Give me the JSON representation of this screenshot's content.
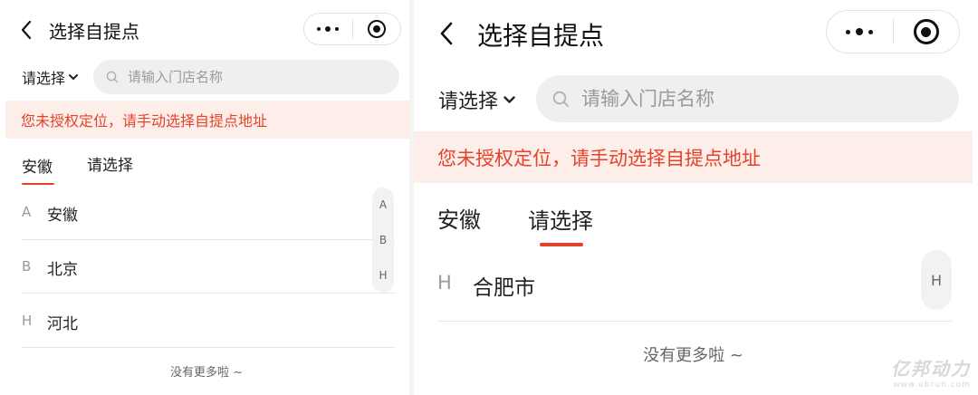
{
  "left": {
    "title": "选择自提点",
    "select_label": "请选择",
    "search_placeholder": "请输入门店名称",
    "notice": "您未授权定位，请手动选择自提点地址",
    "tabs": [
      {
        "label": "安徽",
        "active": true
      },
      {
        "label": "请选择",
        "active": false
      }
    ],
    "items": [
      {
        "letter": "A",
        "name": "安徽"
      },
      {
        "letter": "B",
        "name": "北京"
      },
      {
        "letter": "H",
        "name": "河北"
      }
    ],
    "index": [
      "A",
      "B",
      "H"
    ],
    "footer": "没有更多啦 ~"
  },
  "right": {
    "title": "选择自提点",
    "select_label": "请选择",
    "search_placeholder": "请输入门店名称",
    "notice": "您未授权定位，请手动选择自提点地址",
    "tabs": [
      {
        "label": "安徽",
        "active": false
      },
      {
        "label": "请选择",
        "active": true
      }
    ],
    "items": [
      {
        "letter": "H",
        "name": "合肥市"
      }
    ],
    "index": [
      "H"
    ],
    "footer": "没有更多啦 ~"
  },
  "watermark": {
    "brand": "亿邦动力",
    "url": "www.ebrun.com"
  },
  "colors": {
    "accent": "#e4432a",
    "notice_bg": "#fdeeea",
    "search_bg": "#efefef"
  },
  "icons": [
    "back-arrow-icon",
    "more-dots-icon",
    "target-close-icon",
    "chevron-down-icon",
    "search-icon"
  ]
}
